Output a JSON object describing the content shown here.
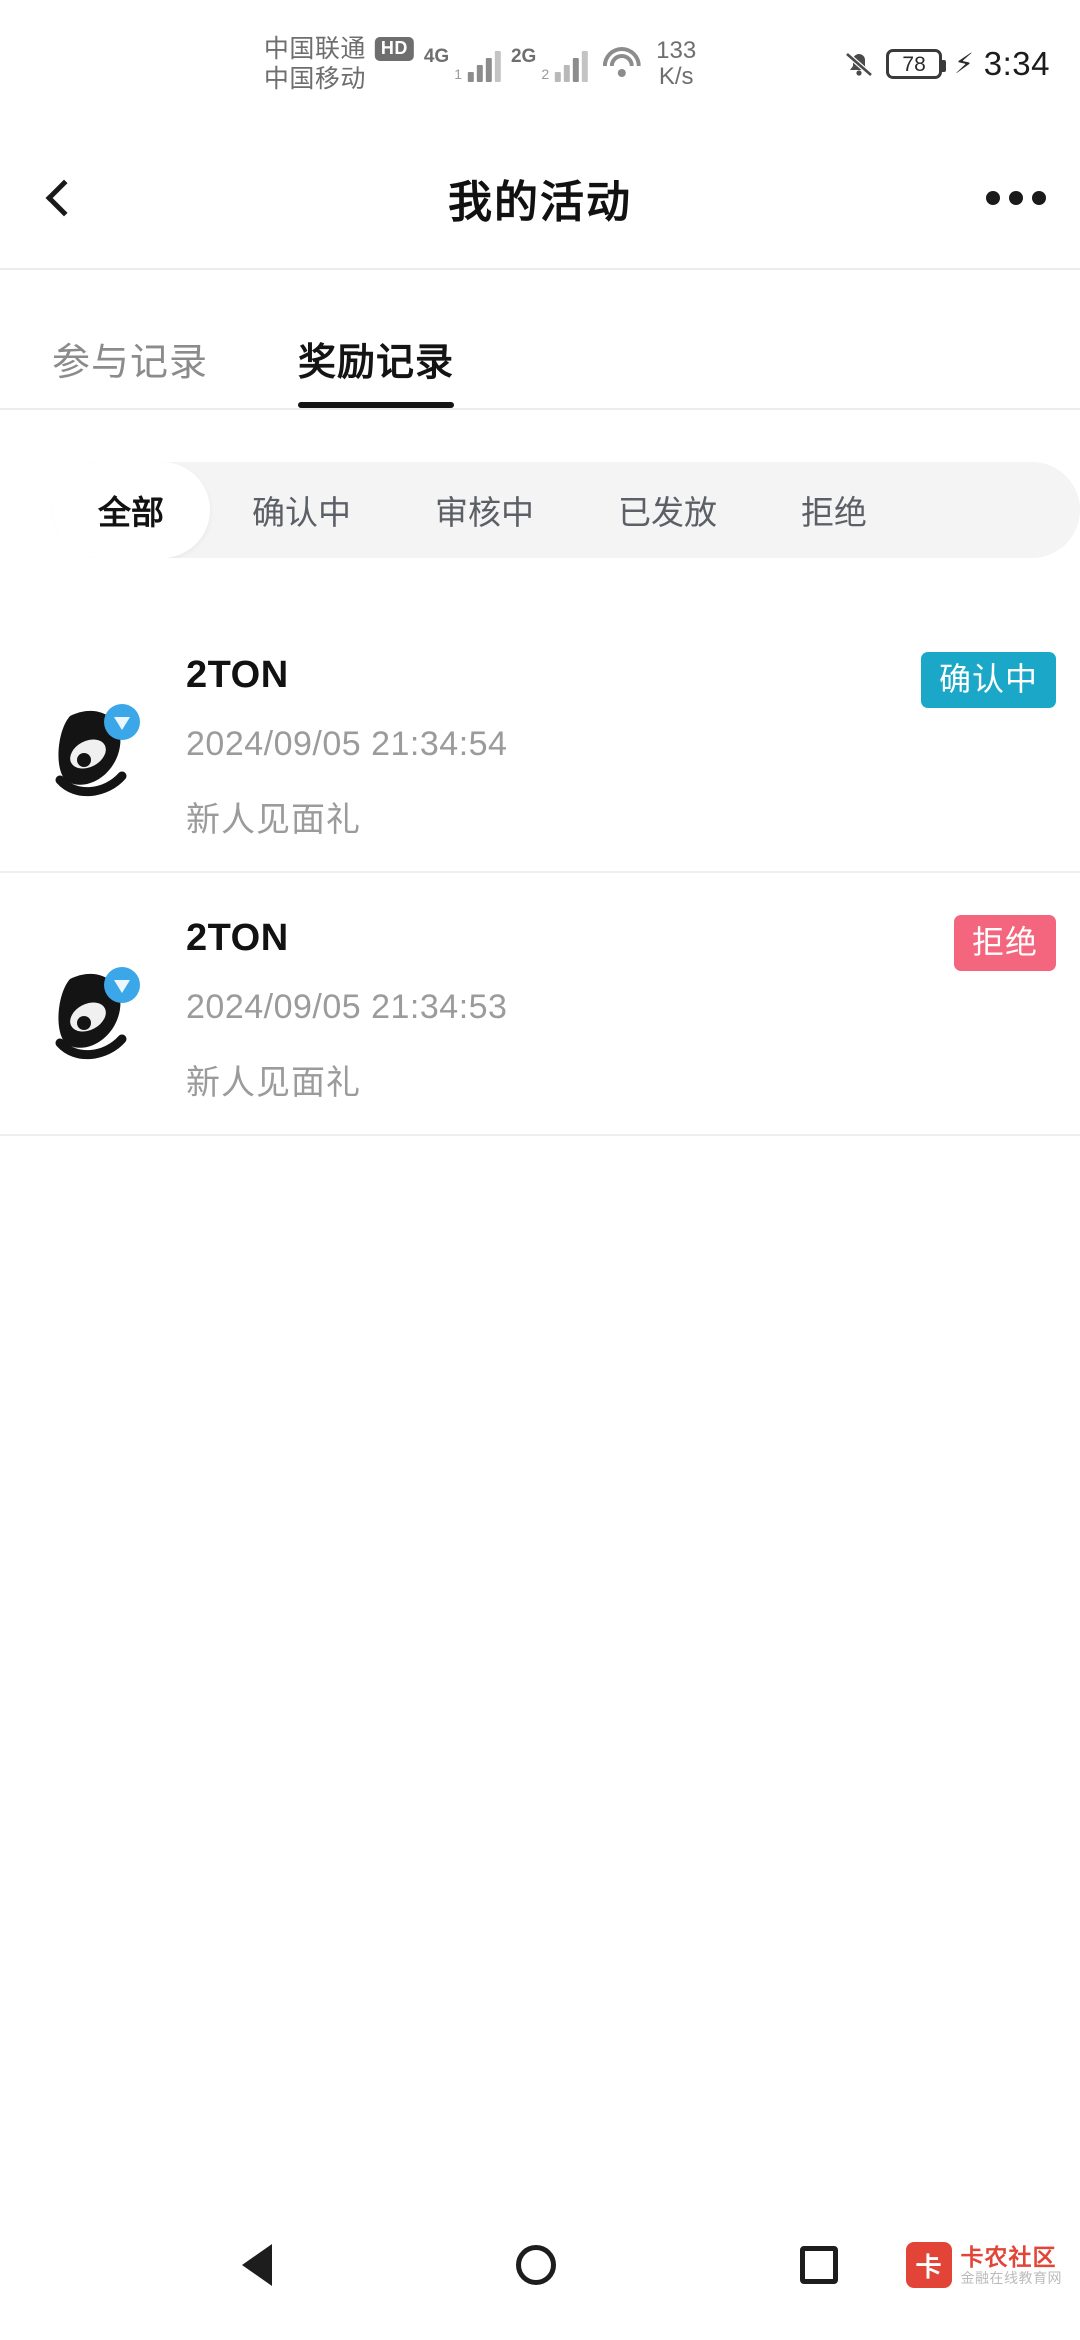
{
  "status_bar": {
    "carrier_primary": "中国联通",
    "carrier_primary_badge": "HD",
    "carrier_secondary": "中国移动",
    "network_primary": "4G",
    "network_secondary": "2G",
    "net_speed_value": "133",
    "net_speed_unit": "K/s",
    "battery_percent": "78",
    "charging_glyph": "⚡",
    "time": "3:34"
  },
  "header": {
    "title": "我的活动",
    "back_label": "返回",
    "more_label": "更多"
  },
  "tabs": [
    {
      "label": "参与记录",
      "active": false
    },
    {
      "label": "奖励记录",
      "active": true
    }
  ],
  "filters": [
    {
      "label": "全部",
      "active": true
    },
    {
      "label": "确认中",
      "active": false
    },
    {
      "label": "审核中",
      "active": false
    },
    {
      "label": "已发放",
      "active": false
    },
    {
      "label": "拒绝",
      "active": false
    }
  ],
  "list": [
    {
      "name": "2TON",
      "time": "2024/09/05 21:34:54",
      "desc": "新人见面礼",
      "status": "确认中",
      "status_color": "#1aa7c8"
    },
    {
      "name": "2TON",
      "time": "2024/09/05 21:34:53",
      "desc": "新人见面礼",
      "status": "拒绝",
      "status_color": "#f4667e"
    }
  ],
  "nav_bar": {
    "back_label": "返回",
    "home_label": "主页",
    "recents_label": "最近任务"
  },
  "watermark": {
    "logo_glyph": "卡",
    "title": "卡农社区",
    "subtitle": "金融在线教育网"
  },
  "colors": {
    "accent_cyan": "#1aa7c8",
    "accent_pink": "#f4667e",
    "text_primary": "#121212",
    "text_muted": "#9b9b9b"
  }
}
